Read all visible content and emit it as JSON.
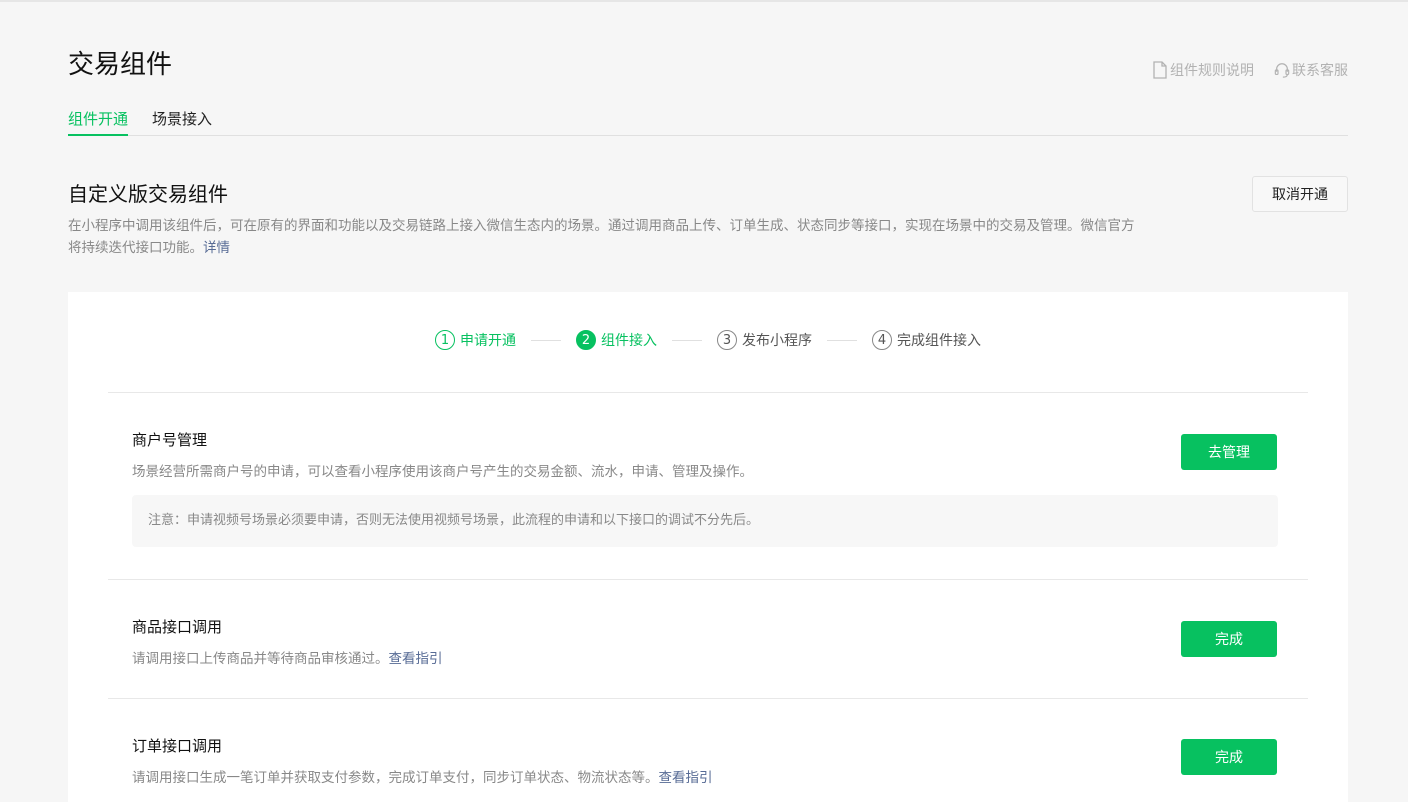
{
  "header": {
    "title": "交易组件",
    "links": [
      {
        "label": "组件规则说明",
        "icon": "document-icon"
      },
      {
        "label": "联系客服",
        "icon": "headset-icon"
      }
    ]
  },
  "tabs": [
    {
      "label": "组件开通",
      "active": true
    },
    {
      "label": "场景接入",
      "active": false
    }
  ],
  "section": {
    "title": "自定义版交易组件",
    "desc": "在小程序中调用该组件后，可在原有的界面和功能以及交易链路上接入微信生态内的场景。通过调用商品上传、订单生成、状态同步等接口，实现在场景中的交易及管理。微信官方将持续迭代接口功能。",
    "detail_link": "详情",
    "cancel_label": "取消开通"
  },
  "steps": [
    {
      "num": "1",
      "label": "申请开通",
      "state": "done"
    },
    {
      "num": "2",
      "label": "组件接入",
      "state": "active"
    },
    {
      "num": "3",
      "label": "发布小程序",
      "state": "pending"
    },
    {
      "num": "4",
      "label": "完成组件接入",
      "state": "pending"
    }
  ],
  "items": [
    {
      "title": "商户号管理",
      "desc": "场景经营所需商户号的申请，可以查看小程序使用该商户号产生的交易金额、流水，申请、管理及操作。",
      "button": "去管理",
      "notice": "注意：申请视频号场景必须要申请，否则无法使用视频号场景，此流程的申请和以下接口的调试不分先后。"
    },
    {
      "title": "商品接口调用",
      "desc": "请调用接口上传商品并等待商品审核通过。",
      "link": "查看指引",
      "button": "完成"
    },
    {
      "title": "订单接口调用",
      "desc": "请调用接口生成一笔订单并获取支付参数，完成订单支付，同步订单状态、物流状态等。",
      "link": "查看指引",
      "button": "完成"
    }
  ],
  "colors": {
    "accent": "#07c160",
    "link": "#576b95"
  }
}
